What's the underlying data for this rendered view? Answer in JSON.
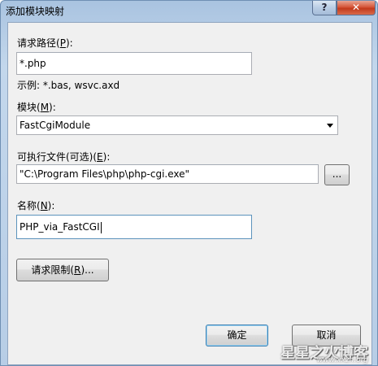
{
  "window": {
    "title": "添加模块映射",
    "help_glyph": "?",
    "close_glyph": "✕"
  },
  "request_path": {
    "label": "请求路径(",
    "mnemonic": "P",
    "label_end": "):",
    "value": "*.php",
    "example": "示例: *.bas, wsvc.axd"
  },
  "module": {
    "label": "模块(",
    "mnemonic": "M",
    "label_end": "):",
    "selected": "FastCgiModule"
  },
  "executable": {
    "label": "可执行文件(可选)(",
    "mnemonic": "E",
    "label_end": "):",
    "value": "\"C:\\Program Files\\php\\php-cgi.exe\"",
    "browse_label": "..."
  },
  "name": {
    "label": "名称(",
    "mnemonic": "N",
    "label_end": "):",
    "value": "PHP_via_FastCGI"
  },
  "restrictions": {
    "label": "请求限制(",
    "mnemonic": "R",
    "label_end": ")..."
  },
  "footer": {
    "ok_label": "确定",
    "cancel_label": "取消",
    "watermark": "星星之火博客",
    "watermark_url": "www.xxzh.org"
  }
}
